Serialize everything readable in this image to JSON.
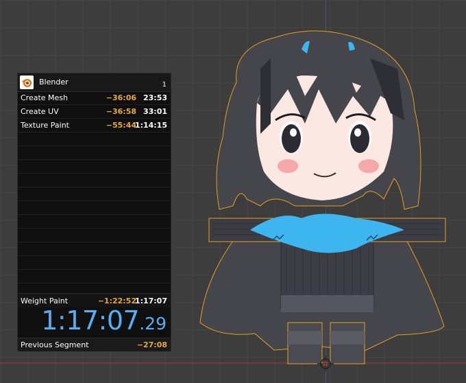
{
  "splits": {
    "app_title": "Blender",
    "attempt_count": "1",
    "segments": [
      {
        "name": "Create Mesh",
        "delta": "−36:06",
        "time": "23:53"
      },
      {
        "name": "Create UV",
        "delta": "−36:58",
        "time": "33:01"
      },
      {
        "name": "Texture Paint",
        "delta": "−55:44",
        "time": "1:14:15"
      }
    ],
    "current_segment": {
      "name": "Weight Paint",
      "delta": "−1:22:52",
      "time": "1:17:07"
    },
    "timer": {
      "main": "1:17:07",
      "fraction": ".29"
    },
    "previous_segment": {
      "label": "Previous Segment",
      "value": "−27:08"
    }
  },
  "colors": {
    "timer_blue": "#57aef2",
    "delta_gold": "#e8a83a",
    "viewport_bg": "#3d3d3d",
    "selection_outline": "#e8a020"
  },
  "icons": {
    "app_logo": "blender-logo-icon",
    "origin": "object-origin-icon"
  }
}
